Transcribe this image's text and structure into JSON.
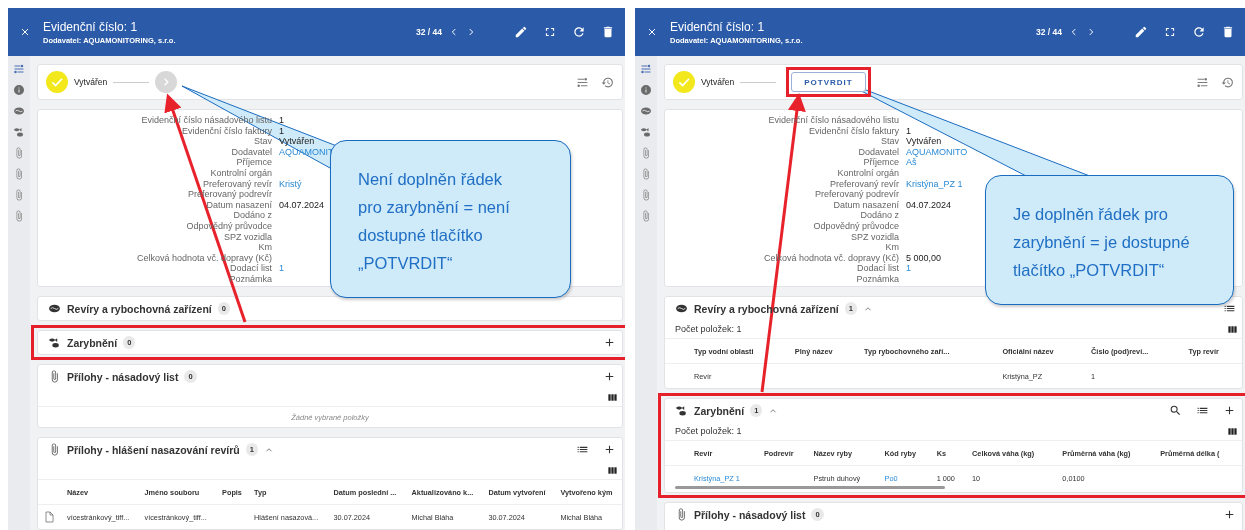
{
  "panels": [
    {
      "title": "Evidenční číslo: 1",
      "subtitle": "Dodavatel: AQUAMONITORING, s.r.o.",
      "pager": "32 / 44",
      "status": {
        "step": "Vytvářen",
        "next": {
          "kind": "disabled"
        }
      },
      "details": [
        {
          "label": "Evidenční číslo násadového listu",
          "value": "1"
        },
        {
          "label": "Evidenční číslo faktury",
          "value": "1"
        },
        {
          "label": "Stav",
          "value": "Vytvářen"
        },
        {
          "label": "Dodavatel",
          "value": "AQUAMONIT",
          "link": true
        },
        {
          "label": "Příjemce"
        },
        {
          "label": "Kontrolní orgán"
        },
        {
          "label": "Preferovaný revír",
          "value": "Kristý",
          "link": true
        },
        {
          "label": "Preferovaný podrevír"
        },
        {
          "label": "Datum nasazení",
          "value": "04.07.2024"
        },
        {
          "label": "Dodáno z"
        },
        {
          "label": "Odpovědný průvodce"
        },
        {
          "label": "SPZ vozidla"
        },
        {
          "label": "Km"
        },
        {
          "label": "Celková hodnota vč. dopravy (Kč)"
        },
        {
          "label": "Dodací list",
          "value": "1",
          "link": true
        },
        {
          "label": "Poznámka"
        }
      ],
      "sections": [
        {
          "kind": "waters",
          "title": "Revíry a rybochovná zařízení",
          "count": "0",
          "expanded": false,
          "highlighted": false
        },
        {
          "kind": "stocking",
          "title": "Zarybnění",
          "count": "0",
          "expanded": false,
          "highlighted": true
        },
        {
          "kind": "attachments",
          "title": "Přílohy - násadový list",
          "count": "0",
          "expanded": false,
          "highlighted": false,
          "empty": "Žádné vybrané položky"
        },
        {
          "kind": "attachments",
          "title": "Přílohy - hlášení nasazování revírů",
          "count": "1",
          "expanded": true,
          "highlighted": false,
          "columns": [
            "Název",
            "Jméno souboru",
            "Popis",
            "Typ",
            "Datum poslední ...",
            "Aktualizováno k...",
            "Datum vytvoření",
            "Vytvořeno kým"
          ],
          "rows": [
            {
              "kind": "file",
              "cells": [
                {
                  "text": "vícestránkový_tiff..."
                },
                {
                  "text": "vícestránkový_tiff..."
                },
                null,
                {
                  "text": "Hlášení nasazová..."
                },
                {
                  "text": "30.07.2024"
                },
                {
                  "text": "Michal Bláha"
                },
                {
                  "text": "30.07.2024"
                },
                {
                  "text": "Michal Bláha"
                }
              ]
            }
          ]
        }
      ],
      "callout": "Není doplněn řádek pro zarybnění = není dostupné tlačítko „POTVRDIT“"
    },
    {
      "title": "Evidenční číslo: 1",
      "subtitle": "Dodavatel: AQUAMONITORING, s.r.o.",
      "pager": "32 / 44",
      "status": {
        "step": "Vytvářen",
        "next": {
          "kind": "button",
          "label": "POTVRDIT",
          "highlighted": true
        }
      },
      "details": [
        {
          "label": "Evidenční číslo násadového listu"
        },
        {
          "label": "Evidenční číslo faktury",
          "value": "1"
        },
        {
          "label": "Stav",
          "value": "Vytvářen"
        },
        {
          "label": "Dodavatel",
          "value": "AQUAMONITO",
          "link": true
        },
        {
          "label": "Příjemce",
          "value": "Aš",
          "link": true
        },
        {
          "label": "Kontrolní orgán"
        },
        {
          "label": "Preferovaný revír",
          "value": "Kristýna_PZ 1",
          "link": true
        },
        {
          "label": "Preferovaný podrevír"
        },
        {
          "label": "Datum nasazení",
          "value": "04.07.2024"
        },
        {
          "label": "Dodáno z"
        },
        {
          "label": "Odpovědný průvodce"
        },
        {
          "label": "SPZ vozidla"
        },
        {
          "label": "Km"
        },
        {
          "label": "Celková hodnota vč. dopravy (Kč)",
          "value": "5 000,00"
        },
        {
          "label": "Dodací list",
          "value": "1",
          "link": true
        },
        {
          "label": "Poznámka"
        }
      ],
      "sections": [
        {
          "kind": "waters",
          "title": "Revíry a rybochovná zařízení",
          "count": "1",
          "expanded": true,
          "highlighted": false,
          "count_text": "Počet položek: 1",
          "columns": [
            "Typ vodní oblasti",
            "Plný název",
            "Typ rybochovného zaří...",
            "Oficiální název",
            "Číslo (pod)reví...",
            "Typ revír"
          ],
          "rows": [
            {
              "kind": "plain",
              "cells": [
                {
                  "text": "Revír"
                },
                null,
                null,
                {
                  "text": "Kristýna_PZ"
                },
                {
                  "text": "1"
                },
                null
              ]
            }
          ]
        },
        {
          "kind": "stocking",
          "title": "Zarybnění",
          "count": "1",
          "expanded": true,
          "highlighted": true,
          "count_text": "Počet položek: 1",
          "columns": [
            "Revír",
            "Podrevír",
            "Název ryby",
            "Kód ryby",
            "Ks",
            "Celková váha (kg)",
            "Průměrná váha (kg)",
            "Průměrná délka ("
          ],
          "rows": [
            {
              "kind": "plain",
              "cells": [
                {
                  "text": "Kristýna_PZ 1",
                  "link": true
                },
                null,
                {
                  "text": "Pstruh duhový"
                },
                {
                  "text": "Po0",
                  "link": true
                },
                {
                  "text": "1 000"
                },
                {
                  "text": "10"
                },
                {
                  "text": "0,0100"
                },
                null
              ]
            }
          ]
        },
        {
          "kind": "attachments",
          "title": "Přílohy - násadový list",
          "count": "0",
          "expanded": false,
          "highlighted": false
        }
      ],
      "callout": "Je doplněn řádek pro zarybnění = je dostupné tlačítko „POTVRDIT“"
    }
  ]
}
